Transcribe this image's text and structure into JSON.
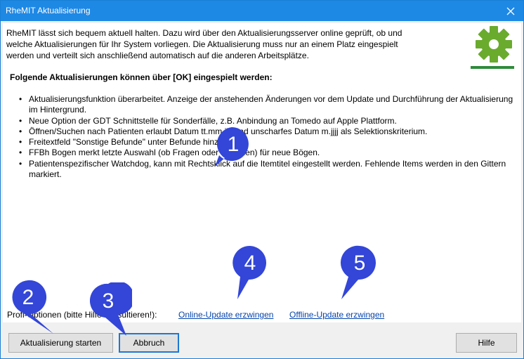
{
  "window": {
    "title": "RheMIT Aktualisierung"
  },
  "intro": {
    "line1": "RheMIT lässt sich bequem aktuell halten. Dazu wird über den Aktualisierungsserver online geprüft, ob und",
    "line2": "welche Aktualisierungen für Ihr System vorliegen. Die Aktualisierung muss nur an einem Platz eingespielt",
    "line3": "werden und verteilt sich anschließend automatisch auf die anderen Arbeitsplätze."
  },
  "heading": "Folgende Aktualisierungen können über [OK] eingespielt werden:",
  "changes": [
    "Aktualisierungsfunktion überarbeitet. Anzeige der anstehenden Änderungen vor dem Update und Durchführung der Aktualisierung im Hintergrund.",
    "Neue Option der GDT Schnittstelle für Sonderfälle, z.B. Anbindung an Tomedo auf Apple Plattform.",
    "Öffnen/Suchen nach Patienten erlaubt Datum tt.mm.jjjj und unscharfes Datum m.jjjj als Selektionskriterium.",
    "Freitextfeld \"Sonstige Befunde\" unter Befunde hinzugefügt.",
    "FFBh Bogen merkt letzte Auswahl (ob Fragen oder Summen) für neue Bögen.",
    "Patientenspezifischer Watchdog, kann mit Rechtsklick auf die Itemtitel eingestellt werden. Fehlende Items werden in den Gittern markiert."
  ],
  "profi": {
    "label": "Profi-Optionen (bitte Hilfe konsultieren!):",
    "online_link": "Online-Update erzwingen",
    "offline_link": "Offline-Update erzwingen"
  },
  "buttons": {
    "start": "Aktualisierung starten",
    "cancel": "Abbruch",
    "help": "Hilfe"
  },
  "callouts": [
    "1",
    "2",
    "3",
    "4",
    "5"
  ],
  "colors": {
    "titlebar": "#1e88e5",
    "gear": "#6aab2e",
    "gear_line": "#2e8b3a",
    "callout": "#3346d8",
    "link": "#0645ad"
  },
  "icons": {
    "close": "close-icon",
    "gear": "gear-icon"
  }
}
